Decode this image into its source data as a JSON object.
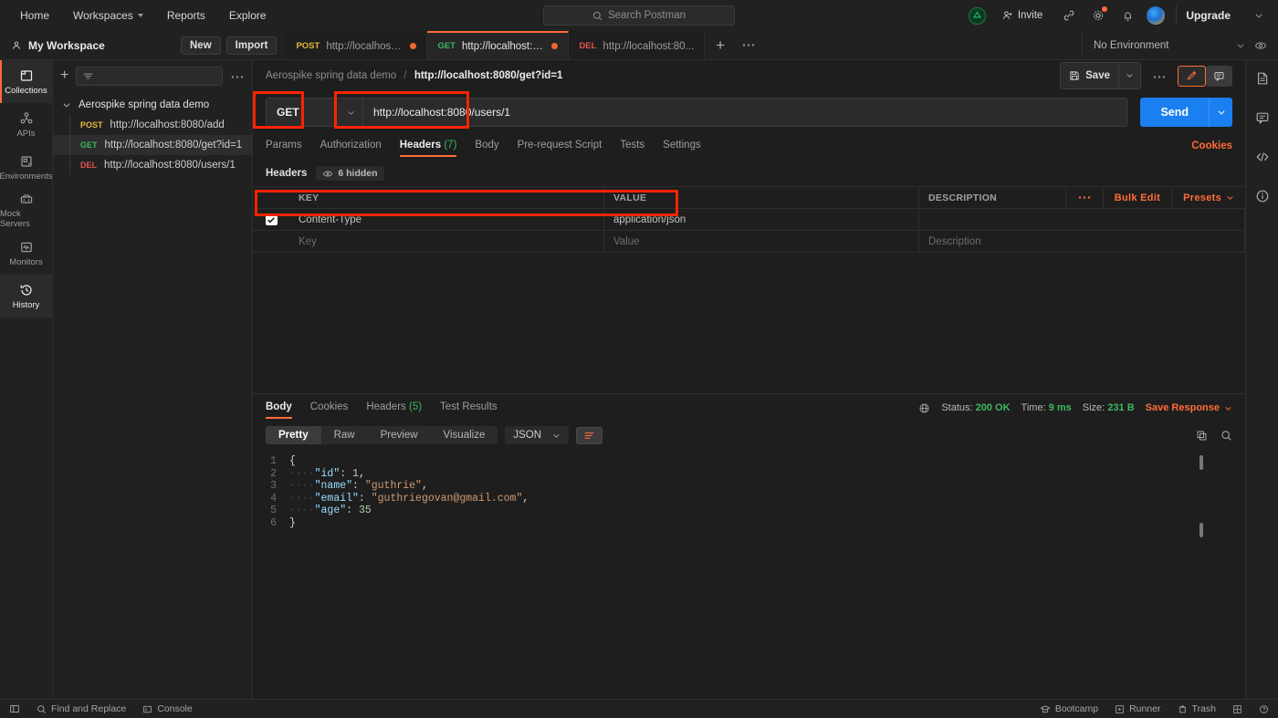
{
  "topnav": {
    "items": [
      {
        "label": "Home",
        "caret": false
      },
      {
        "label": "Workspaces",
        "caret": true
      },
      {
        "label": "Reports",
        "caret": false
      },
      {
        "label": "Explore",
        "caret": false
      }
    ],
    "search_placeholder": "Search Postman",
    "invite_label": "Invite",
    "upgrade_label": "Upgrade",
    "icons": [
      "sync-icon",
      "invite-icon",
      "link-icon",
      "gear-icon",
      "bell-icon",
      "avatar-icon"
    ]
  },
  "workspace": {
    "name": "My Workspace",
    "new_label": "New",
    "import_label": "Import",
    "env_label": "No Environment"
  },
  "tabs": [
    {
      "method": "POST",
      "title": "http://localhost:8...",
      "active": false,
      "unsaved": true
    },
    {
      "method": "GET",
      "title": "http://localhost:80...",
      "active": true,
      "unsaved": true
    },
    {
      "method": "DEL",
      "title": "http://localhost:80...",
      "active": false,
      "unsaved": false
    }
  ],
  "rail": [
    {
      "label": "Collections",
      "icon": "collections-icon",
      "state": "active"
    },
    {
      "label": "APIs",
      "icon": "apis-icon",
      "state": "none"
    },
    {
      "label": "Environments",
      "icon": "environments-icon",
      "state": "none"
    },
    {
      "label": "Mock Servers",
      "icon": "mock-servers-icon",
      "state": "none"
    },
    {
      "label": "Monitors",
      "icon": "monitors-icon",
      "state": "none"
    },
    {
      "label": "History",
      "icon": "history-icon",
      "state": "selected"
    }
  ],
  "sidebar": {
    "collection_name": "Aerospike spring data demo",
    "requests": [
      {
        "method": "POST",
        "name": "http://localhost:8080/add",
        "selected": false
      },
      {
        "method": "GET",
        "name": "http://localhost:8080/get?id=1",
        "selected": true
      },
      {
        "method": "DEL",
        "name": "http://localhost:8080/users/1",
        "selected": false
      }
    ]
  },
  "request": {
    "breadcrumb_collection": "Aerospike spring data demo",
    "breadcrumb_current": "http://localhost:8080/get?id=1",
    "save_label": "Save",
    "method": "GET",
    "url": "http://localhost:8080/users/1",
    "send_label": "Send",
    "cookies_label": "Cookies",
    "tabs": [
      {
        "label": "Params",
        "count": "",
        "active": false
      },
      {
        "label": "Authorization",
        "count": "",
        "active": false
      },
      {
        "label": "Headers",
        "count": "(7)",
        "active": true
      },
      {
        "label": "Body",
        "count": "",
        "active": false
      },
      {
        "label": "Pre-request Script",
        "count": "",
        "active": false
      },
      {
        "label": "Tests",
        "count": "",
        "active": false
      },
      {
        "label": "Settings",
        "count": "",
        "active": false
      }
    ]
  },
  "headers": {
    "section_title": "Headers",
    "hidden_label": "6 hidden",
    "columns": [
      "KEY",
      "VALUE",
      "DESCRIPTION"
    ],
    "bulk_edit_label": "Bulk Edit",
    "presets_label": "Presets",
    "rows": [
      {
        "checked": true,
        "key": "Content-Type",
        "value": "application/json",
        "description": ""
      }
    ],
    "placeholder_row": {
      "key": "Key",
      "value": "Value",
      "description": "Description"
    }
  },
  "response": {
    "tabs": [
      {
        "label": "Body",
        "count": "",
        "active": true
      },
      {
        "label": "Cookies",
        "count": "",
        "active": false
      },
      {
        "label": "Headers",
        "count": "(5)",
        "active": false
      },
      {
        "label": "Test Results",
        "count": "",
        "active": false
      }
    ],
    "status_label": "Status:",
    "status_value": "200 OK",
    "time_label": "Time:",
    "time_value": "9 ms",
    "size_label": "Size:",
    "size_value": "231 B",
    "save_response_label": "Save Response",
    "view_modes": [
      {
        "label": "Pretty",
        "active": true
      },
      {
        "label": "Raw",
        "active": false
      },
      {
        "label": "Preview",
        "active": false
      },
      {
        "label": "Visualize",
        "active": false
      }
    ],
    "format": "JSON",
    "body_lines": [
      {
        "n": "1",
        "indent": 0,
        "tokens": [
          {
            "t": "{",
            "c": "p"
          }
        ]
      },
      {
        "n": "2",
        "indent": 1,
        "tokens": [
          {
            "t": "\"id\"",
            "c": "k"
          },
          {
            "t": ": ",
            "c": "p"
          },
          {
            "t": "1",
            "c": "n"
          },
          {
            "t": ",",
            "c": "p"
          }
        ]
      },
      {
        "n": "3",
        "indent": 1,
        "tokens": [
          {
            "t": "\"name\"",
            "c": "k"
          },
          {
            "t": ": ",
            "c": "p"
          },
          {
            "t": "\"guthrie\"",
            "c": "s"
          },
          {
            "t": ",",
            "c": "p"
          }
        ]
      },
      {
        "n": "4",
        "indent": 1,
        "tokens": [
          {
            "t": "\"email\"",
            "c": "k"
          },
          {
            "t": ": ",
            "c": "p"
          },
          {
            "t": "\"guthriegovan@gmail.com\"",
            "c": "s"
          },
          {
            "t": ",",
            "c": "p"
          }
        ]
      },
      {
        "n": "5",
        "indent": 1,
        "tokens": [
          {
            "t": "\"age\"",
            "c": "k"
          },
          {
            "t": ": ",
            "c": "p"
          },
          {
            "t": "35",
            "c": "n"
          }
        ]
      },
      {
        "n": "6",
        "indent": 0,
        "tokens": [
          {
            "t": "}",
            "c": "p"
          }
        ]
      }
    ]
  },
  "right_rail": [
    "documentation-icon",
    "comment-icon",
    "code-icon",
    "info-icon"
  ],
  "footer": {
    "left": [
      {
        "label": "Find and Replace",
        "icon": "search-icon"
      },
      {
        "label": "Console",
        "icon": "console-icon"
      }
    ],
    "right": [
      {
        "label": "Bootcamp",
        "icon": "bootcamp-icon"
      },
      {
        "label": "Runner",
        "icon": "runner-icon"
      },
      {
        "label": "Trash",
        "icon": "trash-icon"
      },
      {
        "label": "",
        "icon": "layout-icon"
      },
      {
        "label": "",
        "icon": "help-icon"
      }
    ]
  },
  "colors": {
    "accent": "#ff6c37",
    "send": "#1a7ff0",
    "success": "#3cb95f",
    "annotation": "#fc2403"
  }
}
